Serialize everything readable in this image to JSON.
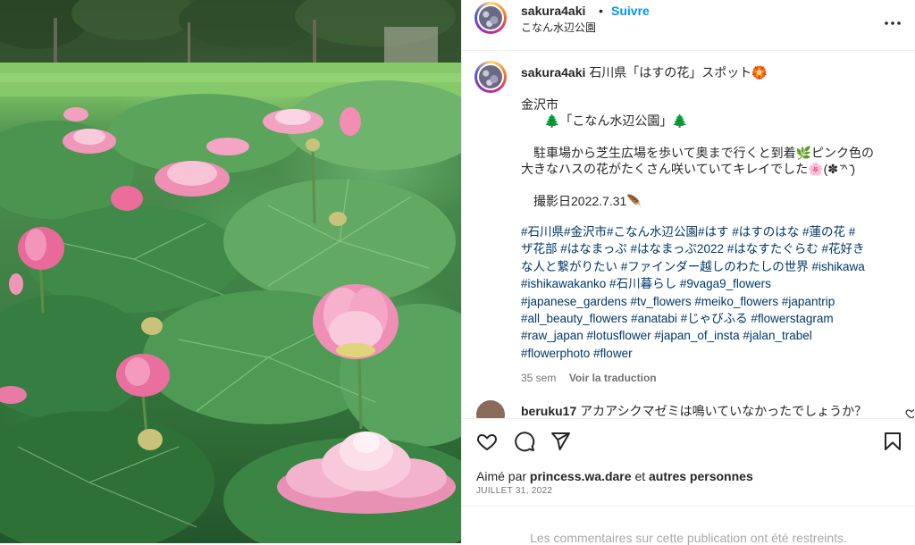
{
  "post": {
    "author": "sakura4aki",
    "dot": "•",
    "follow_label": "Suivre",
    "location": "こなん水辺公園",
    "more_icon": "more-horizontal-icon"
  },
  "caption": {
    "author": "sakura4aki",
    "title": "石川県「はすの花」スポット🏵️",
    "line_city": "金沢市",
    "line_park": "🌲「こなん水辺公園」🌲",
    "line_body1": "駐車場から芝生広場を歩いて奥まで行くと到着🌿ピンク色の",
    "line_body2": "大きなハスの花がたくさん咲いていてキレイでした🌸(✽ ̆^ ̆)",
    "line_date": "撮影日2022.7.31🪶",
    "hashtags_lines": [
      "#石川県#金沢市#こなん水辺公園#はす #はすのはな #蓮の花 #",
      "ザ花部 #はなまっぷ #はなまっぷ2022 #はなすたぐらむ #花好き",
      "な人と繋がりたい #ファインダー越しのわたしの世界 #ishikawa",
      "#ishikawakanko #石川暮らし #9vaga9_flowers",
      "#japanese_gardens #tv_flowers #meiko_flowers #japantrip",
      "#all_beauty_flowers #anatabi #じゃびふる #flowerstagram",
      "#raw_japan #lotusflower #japan_of_insta #jalan_trabel",
      "#flowerphoto #flower"
    ],
    "age": "35 sem",
    "translate_label": "Voir la traduction"
  },
  "comment": {
    "author": "beruku17",
    "text": "アカアシクマゼミは鳴いていなかったでしょうか？"
  },
  "actions": {
    "like_icon": "heart-icon",
    "comment_icon": "comment-icon",
    "share_icon": "share-icon",
    "save_icon": "bookmark-icon"
  },
  "likes": {
    "prefix": "Aimé par",
    "user": "princess.wa.dare",
    "connector": "et",
    "others": "autres personnes"
  },
  "date": "JUILLET 31, 2022",
  "restricted_text": "Les commentaires sur cette publication ont été restreints.",
  "colors": {
    "follow": "#0095f6",
    "hashtag": "#00376b",
    "muted": "#737373"
  }
}
